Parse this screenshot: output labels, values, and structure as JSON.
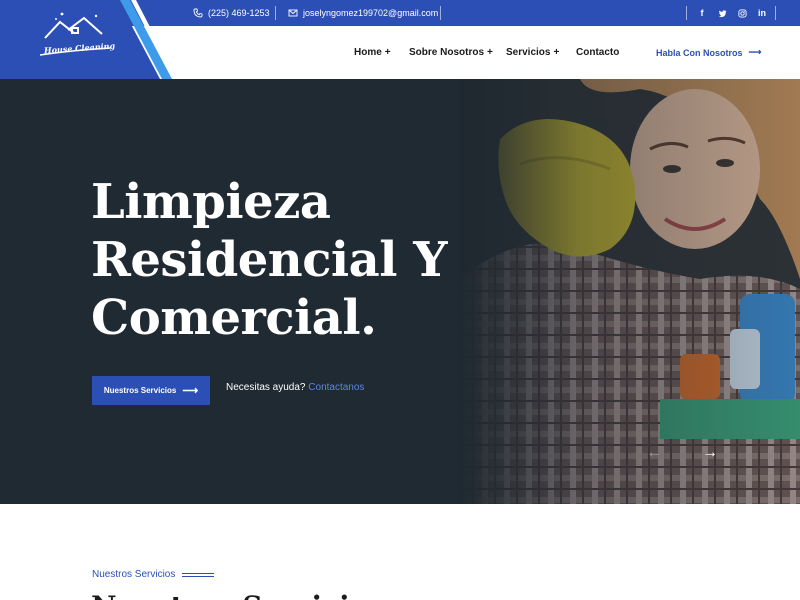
{
  "topbar": {
    "phone": "(225) 469-1253",
    "email": "joselyngomez199702@gmail.com",
    "social": [
      {
        "name": "facebook-icon",
        "label": "f"
      },
      {
        "name": "twitter-icon",
        "label": ""
      },
      {
        "name": "instagram-icon",
        "label": ""
      },
      {
        "name": "linkedin-icon",
        "label": "in"
      }
    ]
  },
  "logo": {
    "text": "House Cleaning"
  },
  "nav": {
    "items": [
      {
        "label": "Home",
        "plus": "+"
      },
      {
        "label": "Sobre Nosotros",
        "plus": "+"
      },
      {
        "label": "Servicios",
        "plus": "+"
      },
      {
        "label": "Contacto",
        "plus": ""
      }
    ],
    "cta": "Habla Con Nosotros",
    "cta_arrow": "⟶"
  },
  "hero": {
    "title_lines": [
      "Limpieza",
      "Residencial Y",
      "Comercial."
    ],
    "button": "Nuestros Servicios",
    "button_arrow": "⟶",
    "help_text": "Necesitas ayuda?",
    "help_link": "Contactanos",
    "prev_arrow": "←",
    "next_arrow": "→"
  },
  "services": {
    "subtitle": "Nuestros Servicios",
    "heading": "Nuestros Servicios"
  },
  "colors": {
    "brand": "#2c4fb6",
    "hero_bg": "#202a32",
    "accent_light": "#5b84e8",
    "stripe": "#3d9be9"
  }
}
